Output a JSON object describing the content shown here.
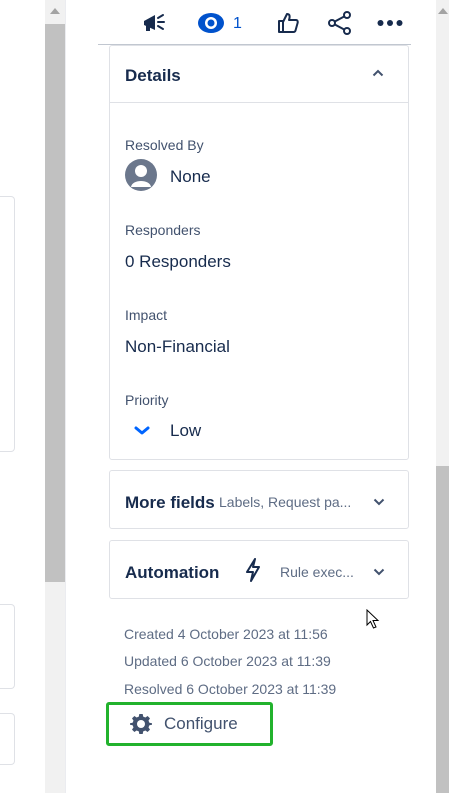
{
  "toolbar": {
    "watch_count": "1"
  },
  "details": {
    "title": "Details",
    "resolved_by": {
      "label": "Resolved By",
      "value": "None"
    },
    "responders": {
      "label": "Responders",
      "value": "0 Responders"
    },
    "impact": {
      "label": "Impact",
      "value": "Non-Financial"
    },
    "priority": {
      "label": "Priority",
      "value": "Low"
    }
  },
  "more_fields": {
    "title": "More fields",
    "summary": "Labels, Request pa..."
  },
  "automation": {
    "title": "Automation",
    "summary": "Rule exec..."
  },
  "meta": {
    "created": "Created 4 October 2023 at 11:56",
    "updated": "Updated 6 October 2023 at 11:39",
    "resolved": "Resolved 6 October 2023 at 11:39"
  },
  "configure_label": "Configure",
  "colors": {
    "accent": "#0052cc",
    "highlight_border": "#22b22d"
  }
}
